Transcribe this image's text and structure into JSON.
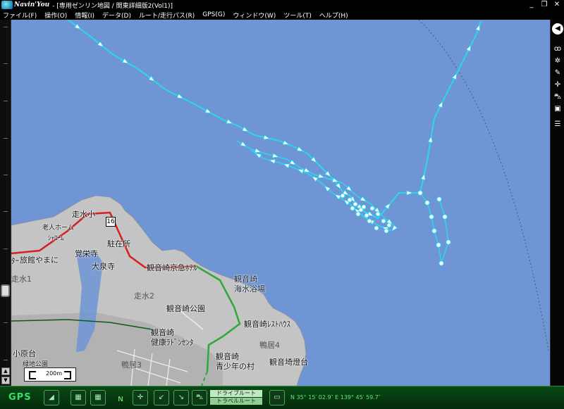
{
  "window": {
    "brand": "Navin'You",
    "title": "- [専用ゼンリン地図 / 関東詳細版2(Vol1)]",
    "minimize_label": "_",
    "restore_label": "❐",
    "close_label": "✕"
  },
  "menu": [
    "ファイル(F)",
    "操作(O)",
    "情報(I)",
    "データ(D)",
    "ルート/走行パス(R)",
    "GPS(G)",
    "ウィンドウ(W)",
    "ツール(T)",
    "ヘルプ(H)"
  ],
  "map": {
    "labels": {
      "sousui": "走水小",
      "rojin": "老人ホーム",
      "syourou": "ｼｬﾛｰﾑ",
      "kakusouji": "覚栄寺",
      "chuzaisho": "駐在所",
      "taisenji": "大泉寺",
      "ryokan": "旅館やまに",
      "center": "ﾀｰ",
      "kannonzaki_station": "観音崎京急ﾎﾃﾙ",
      "kaisuiyokujo_1": "観音崎",
      "kaisuiyokujo_2": "海水浴場",
      "hashirimizu1": "走水1",
      "hashirimizu2": "走水2",
      "koen": "観音崎公園",
      "resthouse": "観音崎ﾚｽﾄﾊｳｽ",
      "kenko_1": "観音崎",
      "kenko_2": "健康ﾗﾄﾞﾝｾﾝﾀ",
      "kamoi4": "鴨居4",
      "seishonen_1": "観音崎",
      "seishonen_2": "青少年の村",
      "todai": "観音埼燈台",
      "oharadai": "小原台",
      "ryokuchi": "緑地公園",
      "kamoi3": "鴨居3",
      "route_number": "16"
    },
    "scale": "200m"
  },
  "bottom": {
    "gps": "GPS",
    "drive_route": "ドライブルート",
    "travel_route": "トラベルルート",
    "coordinates": "N   35° 15′ 02.9″   E  139° 45′ 59.7″",
    "north_label": "N"
  },
  "icons": {
    "nav": "circle-left-arrow-icon",
    "binoculars": "binoculars-icon",
    "gear": "gear-icon",
    "pen": "pen-icon",
    "crosshair": "crosshair-icon",
    "car": "car-icon",
    "play": "play-icon",
    "list": "list-icon"
  },
  "colors": {
    "sea": "#6f95d5",
    "land": "#c3c4c3",
    "track": "#2ad7f0",
    "panel_green": "#0a4a16"
  }
}
